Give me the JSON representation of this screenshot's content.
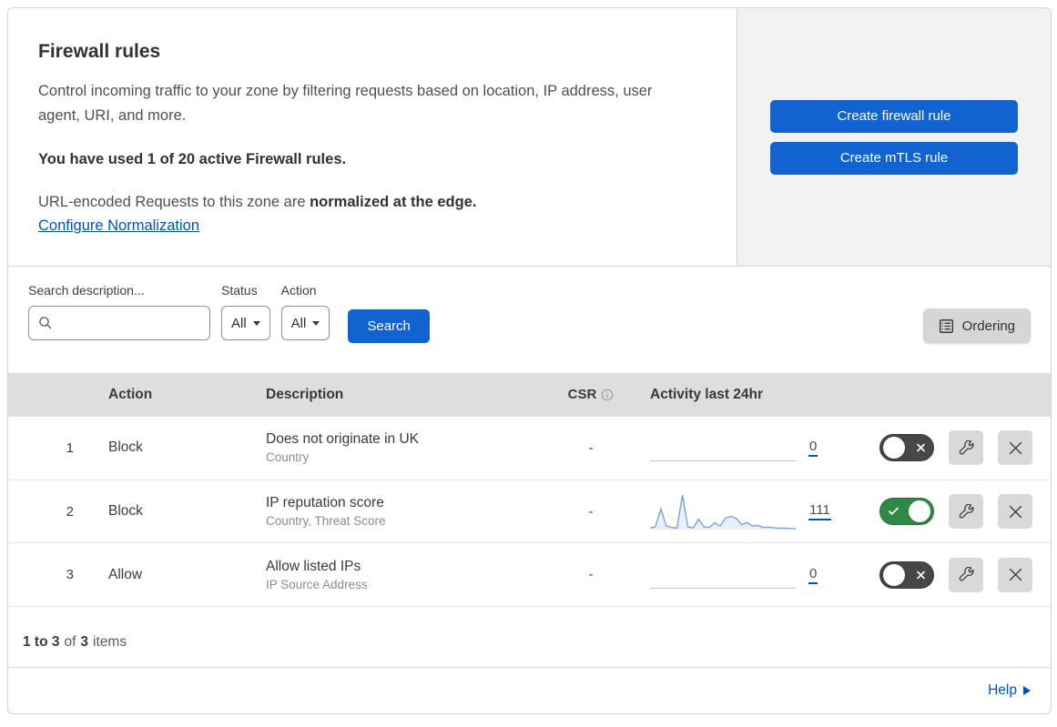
{
  "colors": {
    "button_blue": "#1063d1",
    "link_blue": "#0051c3",
    "toggle_on_green": "#2f8a44",
    "toggle_off_gray": "#47474a",
    "table_header_bg": "#dedede",
    "side_panel_bg": "#f2f2f2",
    "sparkline_blue": "#76a3e6"
  },
  "icons": {
    "search": "magnifier",
    "ordering": "list-document",
    "csr_info": "info-circle",
    "edit": "wrench",
    "delete": "x",
    "toggle_on": "check",
    "toggle_off": "x",
    "help_arrow": "right-triangle",
    "dropdown": "caret-down"
  },
  "header": {
    "title": "Firewall rules",
    "description": "Control incoming traffic to your zone by filtering requests based on location, IP address, user agent, URI, and more.",
    "usage_note": "You have used 1 of 20 active Firewall rules.",
    "normalization_prefix": "URL-encoded Requests to this zone are ",
    "normalization_bold": "normalized at the edge.",
    "normalization_link": "Configure Normalization",
    "create_firewall_rule": "Create firewall rule",
    "create_mtls_rule": "Create mTLS rule"
  },
  "filters": {
    "search_label": "Search description...",
    "search_value": "",
    "status_label": "Status",
    "status_value": "All",
    "action_label": "Action",
    "action_value": "All",
    "search_button": "Search",
    "ordering_button": "Ordering"
  },
  "table": {
    "columns": {
      "action": "Action",
      "description": "Description",
      "csr": "CSR",
      "activity": "Activity last 24hr"
    },
    "rows": [
      {
        "priority": "1",
        "action": "Block",
        "description": "Does not originate in UK",
        "fields": "Country",
        "csr": "-",
        "activity_count": "0",
        "enabled": false
      },
      {
        "priority": "2",
        "action": "Block",
        "description": "IP reputation score",
        "fields": "Country, Threat Score",
        "csr": "-",
        "activity_count": "111",
        "enabled": true,
        "sparkline": [
          5,
          8,
          60,
          10,
          6,
          4,
          100,
          8,
          5,
          30,
          8,
          6,
          20,
          10,
          34,
          38,
          32,
          14,
          20,
          10,
          12,
          6,
          7,
          5,
          4,
          4,
          3,
          3
        ]
      },
      {
        "priority": "3",
        "action": "Allow",
        "description": "Allow listed IPs",
        "fields": "IP Source Address",
        "csr": "-",
        "activity_count": "0",
        "enabled": false
      }
    ]
  },
  "footer": {
    "pagination_range": "1 to 3",
    "pagination_of": "of",
    "pagination_total": "3",
    "pagination_items": "items",
    "help_label": "Help"
  }
}
